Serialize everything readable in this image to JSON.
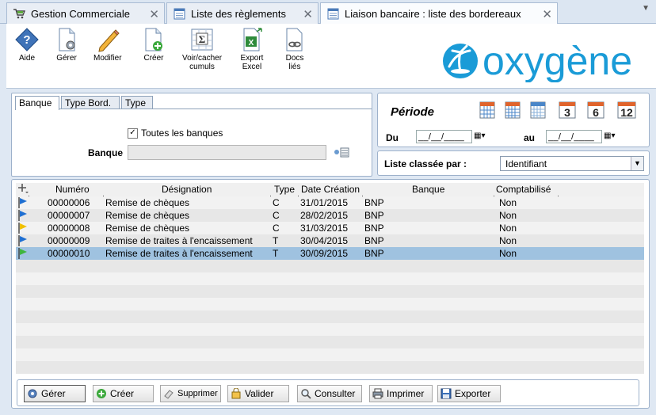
{
  "tabs": [
    {
      "label": "Gestion Commerciale",
      "icon": "cart-icon"
    },
    {
      "label": "Liste des règlements",
      "icon": "list-icon"
    },
    {
      "label": "Liaison bancaire : liste des bordereaux",
      "icon": "list-icon",
      "active": true
    }
  ],
  "toolbar": {
    "aide": "Aide",
    "gerer": "Gérer",
    "modifier": "Modifier",
    "creer": "Créer",
    "voir_cumuls": "Voir/cacher\ncumuls",
    "export_excel": "Export\nExcel",
    "docs_lies": "Docs\nliés"
  },
  "logo_text": "oxygène",
  "filter": {
    "tabs": [
      "Banque",
      "Type Bord.",
      "Type"
    ],
    "toutes_banques_label": "Toutes les banques",
    "toutes_banques_checked": true,
    "banque_label": "Banque",
    "banque_value": ""
  },
  "periode": {
    "title": "Période",
    "du_label": "Du",
    "au_label": "au",
    "du_value": "__/__/____",
    "au_value": "__/__/____",
    "shortcuts": [
      "",
      "",
      "",
      "3",
      "6",
      "12"
    ]
  },
  "sort": {
    "label": "Liste classée par :",
    "value": "Identifiant"
  },
  "grid": {
    "headers": [
      "Numéro",
      "Désignation",
      "Type",
      "Date Création",
      "Banque",
      "Comptabilisé"
    ],
    "rows": [
      {
        "flag": "blue",
        "numero": "00000006",
        "designation": "Remise de chèques",
        "type": "C",
        "date": "31/01/2015",
        "banque": "BNP",
        "compta": "Non"
      },
      {
        "flag": "blue",
        "numero": "00000007",
        "designation": "Remise de chèques",
        "type": "C",
        "date": "28/02/2015",
        "banque": "BNP",
        "compta": "Non"
      },
      {
        "flag": "yellow",
        "numero": "00000008",
        "designation": "Remise de chèques",
        "type": "C",
        "date": "31/03/2015",
        "banque": "BNP",
        "compta": "Non"
      },
      {
        "flag": "blue",
        "numero": "00000009",
        "designation": "Remise de traites à l'encaissement",
        "type": "T",
        "date": "30/04/2015",
        "banque": "BNP",
        "compta": "Non"
      },
      {
        "flag": "green",
        "numero": "00000010",
        "designation": "Remise de traites à l'encaissement",
        "type": "T",
        "date": "30/09/2015",
        "banque": "BNP",
        "compta": "Non",
        "selected": true
      }
    ]
  },
  "actions": {
    "gerer": "Gérer",
    "creer": "Créer",
    "supprimer": "Supprimer",
    "valider": "Valider",
    "consulter": "Consulter",
    "imprimer": "Imprimer",
    "exporter": "Exporter"
  },
  "colors": {
    "accent": "#1a9bd7",
    "selected_row": "#9fc2e0",
    "flag_blue": "#1f6fd1",
    "flag_yellow": "#f0c000",
    "flag_green": "#3fb53f"
  }
}
